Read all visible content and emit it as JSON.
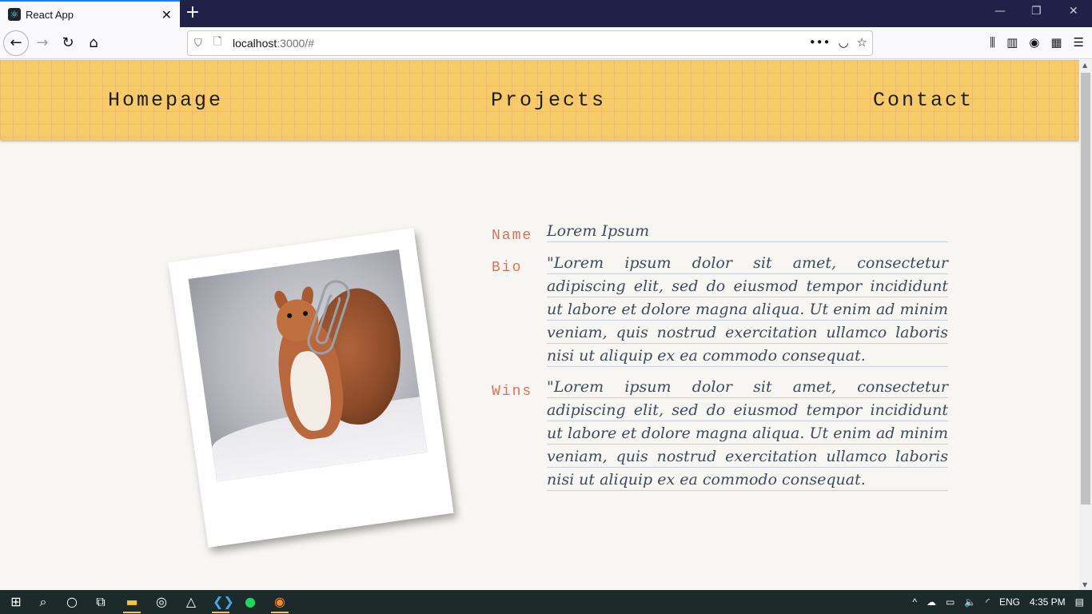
{
  "browser": {
    "tab_title": "React App",
    "tab_close": "✕",
    "new_tab": "+",
    "url_host": "localhost",
    "url_rest": ":3000/#",
    "window_controls": [
      "—",
      "❐",
      "✕"
    ]
  },
  "site": {
    "nav": {
      "home": "Homepage",
      "projects": "Projects",
      "contact": "Contact"
    },
    "profile": {
      "name_label": "Name",
      "name_value": "Lorem Ipsum",
      "bio_label": "Bio",
      "bio_value": "\"Lorem ipsum dolor sit amet, consectetur adipiscing elit, sed do eiusmod tempor incididunt ut labore et dolore magna aliqua. Ut enim ad minim veniam, quis nostrud exercitation ullamco laboris nisi ut aliquip ex ea commodo consequat.",
      "wins_label": "Wins",
      "wins_value": "\"Lorem ipsum dolor sit amet, consectetur adipiscing elit, sed do eiusmod tempor incididunt ut labore et dolore magna aliqua. Ut enim ad minim veniam, quis nostrud exercitation ullamco laboris nisi ut aliquip ex ea commodo consequat."
    }
  },
  "taskbar": {
    "language": "ENG",
    "time": "4:35 PM"
  },
  "colors": {
    "header_bg": "#f8cb6a",
    "label_accent": "#e17055",
    "text": "#3e4a5c",
    "tab_accent": "#0a84ff"
  }
}
